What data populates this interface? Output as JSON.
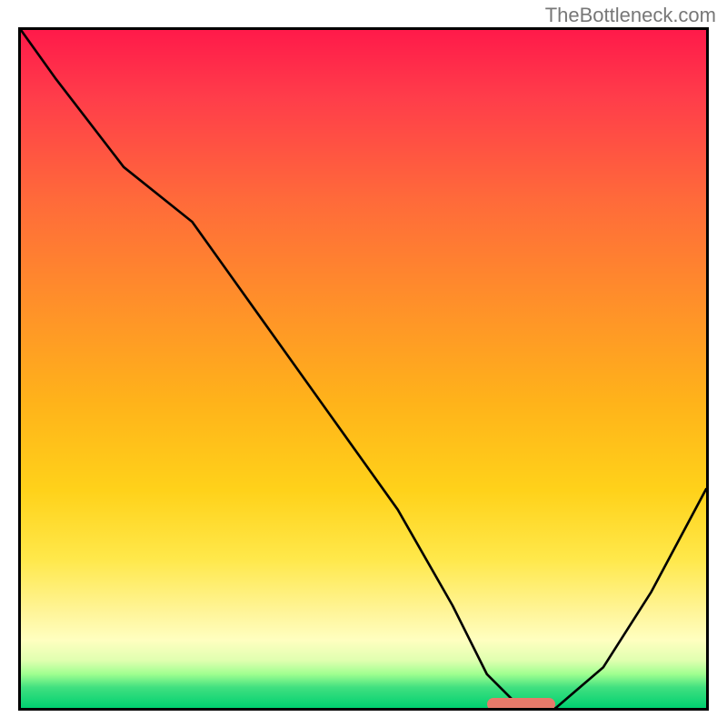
{
  "watermark": "TheBottleneck.com",
  "chart_data": {
    "type": "line",
    "title": "",
    "xlabel": "",
    "ylabel": "",
    "xlim": [
      0,
      100
    ],
    "ylim": [
      0,
      100
    ],
    "grid": false,
    "legend": false,
    "series": [
      {
        "name": "curve",
        "x": [
          0,
          5,
          15,
          25,
          35,
          45,
          55,
          63,
          68,
          73,
          78,
          85,
          92,
          100
        ],
        "y": [
          100,
          93,
          80,
          72,
          58,
          44,
          30,
          16,
          6,
          1,
          1,
          7,
          18,
          33
        ]
      }
    ],
    "marker": {
      "x_start": 68,
      "x_end": 78,
      "y": 0.5
    },
    "gradient": {
      "top_color": "#ff1a4a",
      "mid_color": "#ffd21a",
      "bottom_color": "#00d070"
    }
  }
}
